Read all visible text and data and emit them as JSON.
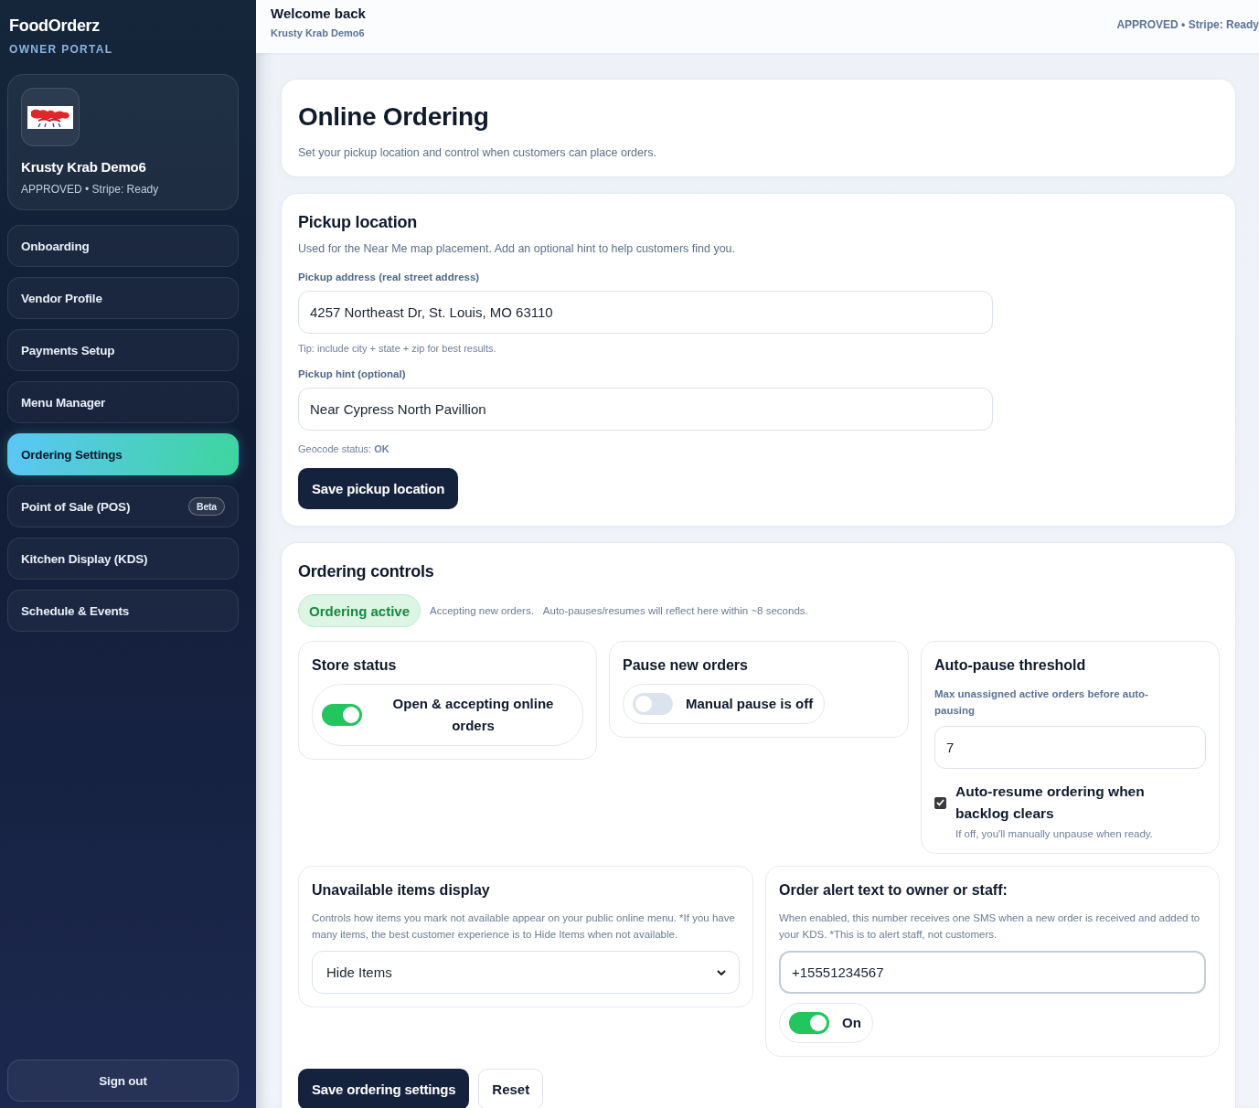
{
  "sidebar": {
    "brand": "FoodOrderz",
    "portal_label": "OWNER PORTAL",
    "vendor": {
      "name": "Krusty Krab Demo6",
      "status": "APPROVED • Stripe: Ready"
    },
    "nav_items": [
      {
        "label": "Onboarding",
        "selected": false
      },
      {
        "label": "Vendor Profile",
        "selected": false
      },
      {
        "label": "Payments Setup",
        "selected": false
      },
      {
        "label": "Menu Manager",
        "selected": false
      },
      {
        "label": "Ordering Settings",
        "selected": true
      },
      {
        "label": "Point of Sale (POS)",
        "selected": false,
        "badge": "Beta"
      },
      {
        "label": "Kitchen Display (KDS)",
        "selected": false
      },
      {
        "label": "Schedule & Events",
        "selected": false
      }
    ],
    "sign_out": "Sign out"
  },
  "header": {
    "greeting": "Welcome back",
    "vendor_name": "Krusty Krab Demo6",
    "status": "APPROVED • Stripe: Ready"
  },
  "page": {
    "title": "Online Ordering",
    "subtitle": "Set your pickup location and control when customers can place orders."
  },
  "pickup_location": {
    "title": "Pickup location",
    "description": "Used for the Near Me map placement. Add an optional hint to help customers find you.",
    "address": {
      "label": "Pickup address (real street address)",
      "value": "4257 Northeast Dr, St. Louis, MO 63110",
      "tip": "Tip: include city + state + zip for best results."
    },
    "hint": {
      "label": "Pickup hint (optional)",
      "value": "Near Cypress North Pavillion"
    },
    "geocode": "Geocode status: **OK**",
    "save_button": "Save pickup location"
  },
  "ordering_controls": {
    "title": "Ordering controls",
    "status_badge": {
      "label": "Ordering active",
      "active": true
    },
    "status_text": "Accepting new orders.",
    "note": "Auto-pauses/resumes will reflect here within ~8 seconds.",
    "store_status": {
      "title": "Store status",
      "toggle": {
        "label": "Open & accepting online orders",
        "on": true
      }
    },
    "pause": {
      "title": "Pause new orders",
      "toggle": {
        "label": "Manual pause is off",
        "on": false
      }
    },
    "auto_pause": {
      "title": "Auto-pause threshold",
      "label": "Max unassigned active orders before auto-pausing",
      "value": "7",
      "auto_resume": {
        "label": "Auto-resume ordering when backlog clears",
        "checked": true,
        "hint": "If off, you'll manually unpause when ready."
      }
    },
    "unavailable": {
      "title": "Unavailable items display",
      "description": "Controls how items you mark not available appear on your public online menu. *If you have many items, the best customer experience is to Hide Items when not available.",
      "selected_option": "Hide Items"
    },
    "order_alert": {
      "title": "Order alert text to owner or staff:",
      "description": "When enabled, this number receives one SMS when a new order is received and added to your KDS. *This is to alert staff, not customers.",
      "phone": "+15551234567",
      "toggle": {
        "label": "On",
        "on": true
      }
    },
    "buttons": {
      "save": "Save ordering settings",
      "reset": "Reset"
    }
  }
}
